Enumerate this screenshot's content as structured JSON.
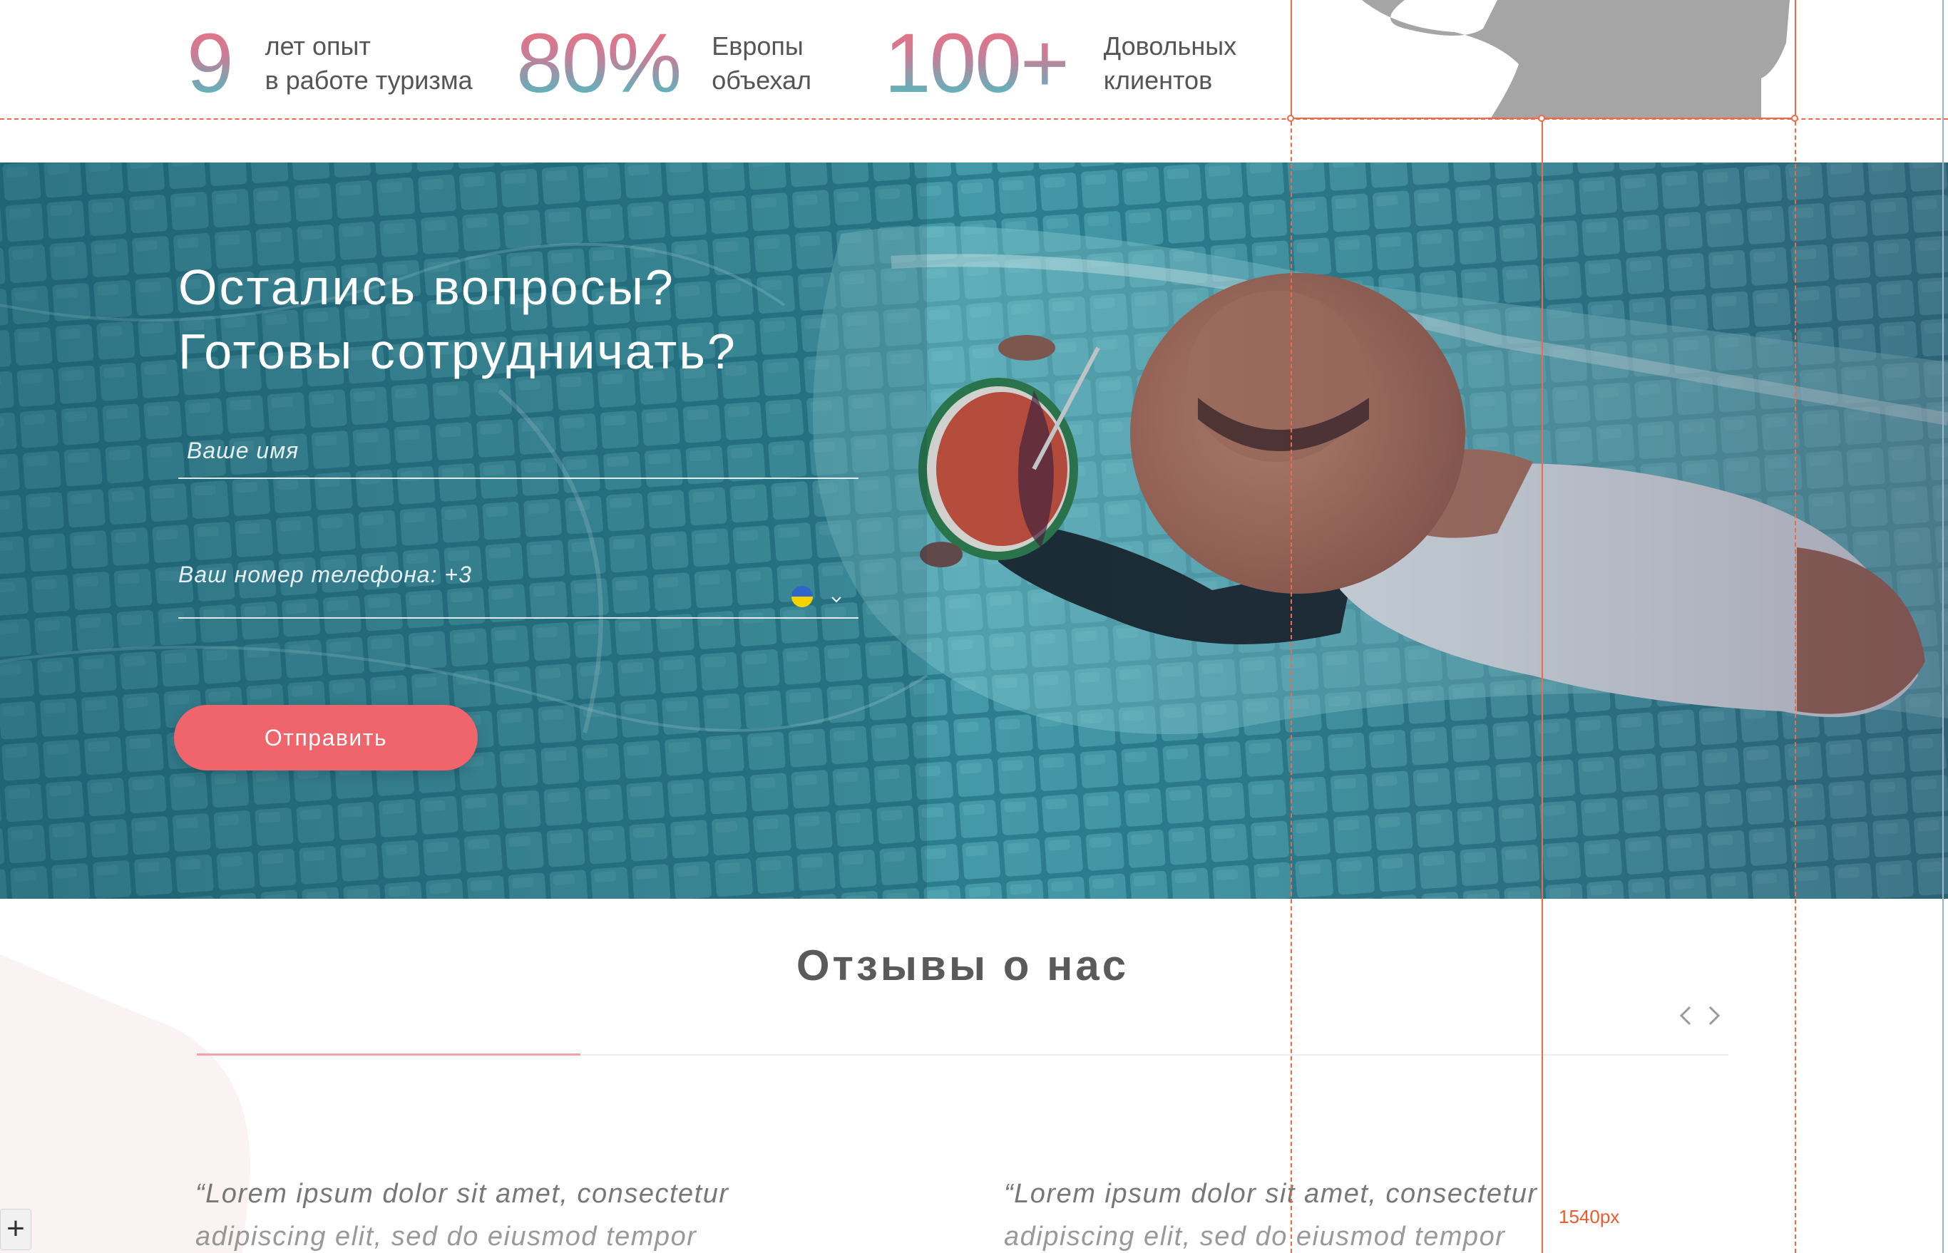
{
  "stats": [
    {
      "number": "9",
      "line1": "лет опыт",
      "line2": "в работе туризма"
    },
    {
      "number": "80%",
      "line1": "Европы",
      "line2": "объехал"
    },
    {
      "number": "100+",
      "line1": "Довольных",
      "line2": "клиентов"
    }
  ],
  "hero": {
    "title_line1": "Остались вопросы?",
    "title_line2": "Готовы сотрудничать?",
    "name_placeholder": "Ваше имя",
    "phone_placeholder": "Ваш номер телефона: +3",
    "submit_label": "Отправить"
  },
  "reviews": {
    "title": "Отзывы о нас",
    "quotes": [
      {
        "line1": "“Lorem ipsum dolor sit amet, consectetur",
        "line2": "adipiscing elit, sed do eiusmod tempor"
      },
      {
        "line1": "“Lorem ipsum dolor sit amet, consectetur",
        "line2": "adipiscing elit, sed do eiusmod tempor"
      }
    ]
  },
  "editor": {
    "measure_label": "1540px",
    "add_label": "+"
  },
  "colors": {
    "accent": "#f0646b",
    "teal": "#3cc4c8",
    "guide": "#ef6a45"
  }
}
